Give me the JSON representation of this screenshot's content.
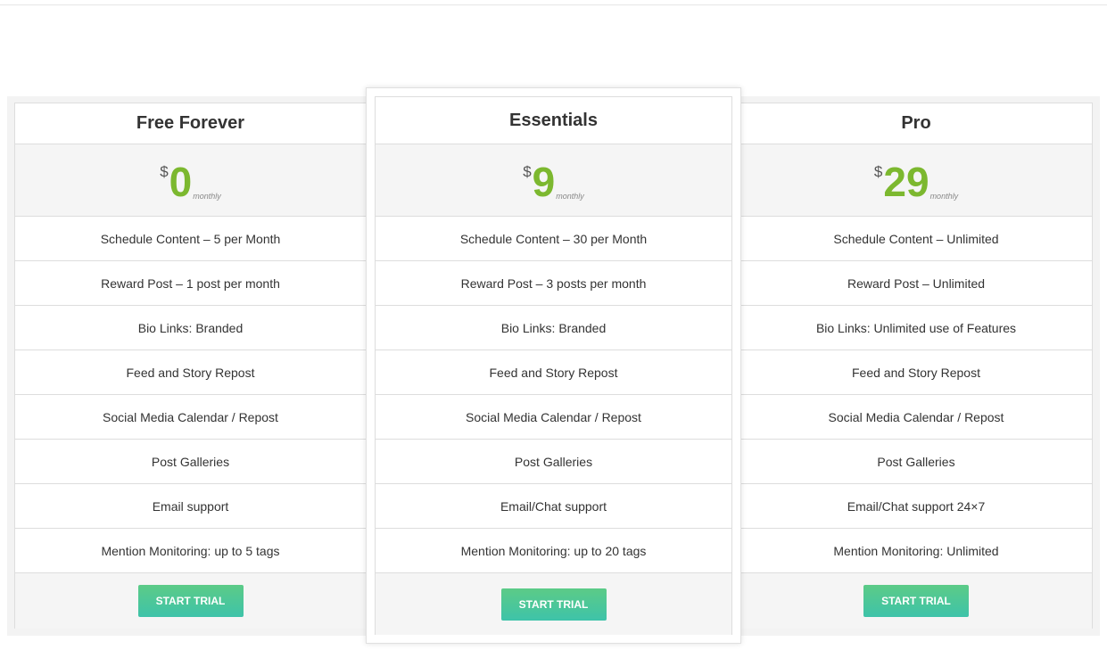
{
  "currency_symbol": "$",
  "period_label": "monthly",
  "accent_color": "#7cb82f",
  "button_color": "#4cc79a",
  "plans": [
    {
      "title": "Free Forever",
      "price": "0",
      "features": [
        "Schedule Content – 5 per Month",
        "Reward Post – 1 post per month",
        "Bio Links: Branded",
        "Feed and Story Repost",
        "Social Media Calendar / Repost",
        "Post Galleries",
        "Email support",
        "Mention Monitoring: up to 5 tags"
      ],
      "cta": "START TRIAL"
    },
    {
      "title": "Essentials",
      "price": "9",
      "featured": true,
      "features": [
        "Schedule Content – 30 per Month",
        "Reward Post – 3 posts per month",
        "Bio Links: Branded",
        "Feed and Story Repost",
        "Social Media Calendar / Repost",
        "Post Galleries",
        "Email/Chat support",
        "Mention Monitoring: up to 20 tags"
      ],
      "cta": "START TRIAL"
    },
    {
      "title": "Pro",
      "price": "29",
      "features": [
        "Schedule Content – Unlimited",
        "Reward Post – Unlimited",
        "Bio Links: Unlimited use of Features",
        "Feed and Story Repost",
        "Social Media Calendar / Repost",
        "Post Galleries",
        "Email/Chat support 24×7",
        "Mention Monitoring: Unlimited"
      ],
      "cta": "START TRIAL"
    }
  ]
}
